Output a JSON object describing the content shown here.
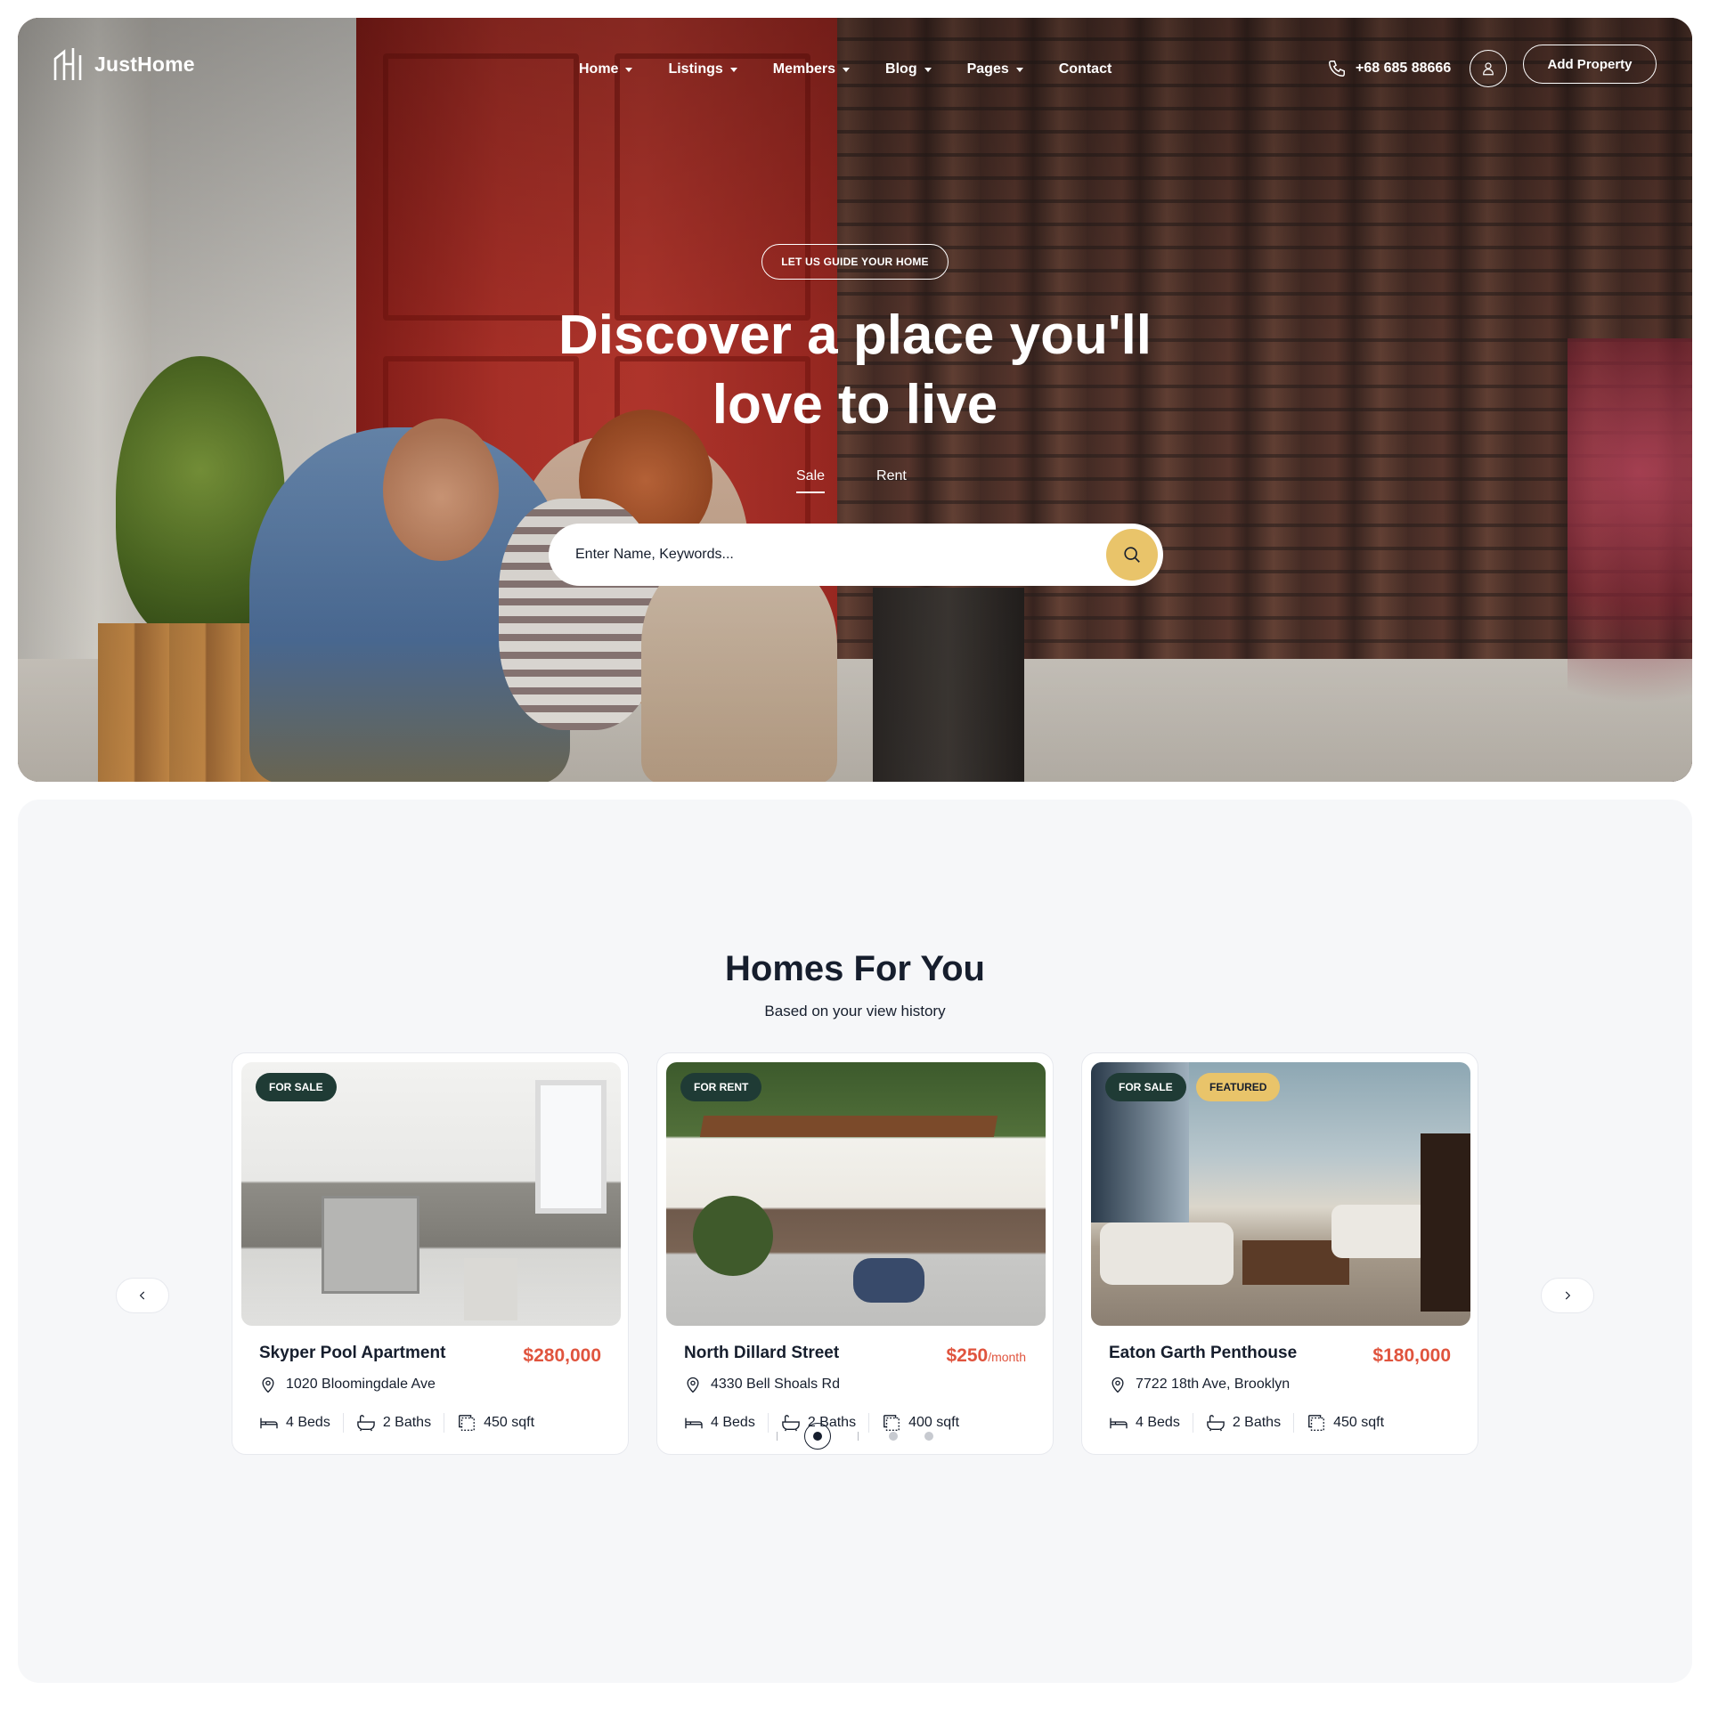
{
  "brand": {
    "name": "JustHome"
  },
  "nav": {
    "items": [
      {
        "label": "Home",
        "has_dropdown": true
      },
      {
        "label": "Listings",
        "has_dropdown": true
      },
      {
        "label": "Members",
        "has_dropdown": true
      },
      {
        "label": "Blog",
        "has_dropdown": true
      },
      {
        "label": "Pages",
        "has_dropdown": true
      },
      {
        "label": "Contact",
        "has_dropdown": false
      }
    ],
    "phone": "+68 685 88666",
    "add_property_label": "Add Property"
  },
  "hero": {
    "badge": "LET US GUIDE YOUR HOME",
    "title_line1": "Discover a place you'll",
    "title_line2": "love to live",
    "tabs": [
      {
        "label": "Sale",
        "active": true
      },
      {
        "label": "Rent",
        "active": false
      }
    ],
    "search_placeholder": "Enter Name, Keywords..."
  },
  "homes": {
    "title": "Homes For You",
    "subtitle": "Based on your view history",
    "listings": [
      {
        "tags": [
          "FOR SALE"
        ],
        "name": "Skyper Pool Apartment",
        "price": "$280,000",
        "price_suffix": "",
        "address": "1020 Bloomingdale Ave",
        "beds": "4 Beds",
        "baths": "2 Baths",
        "area": "450 sqft"
      },
      {
        "tags": [
          "FOR RENT"
        ],
        "name": "North Dillard Street",
        "price": "$250",
        "price_suffix": "/month",
        "address": "4330 Bell Shoals Rd",
        "beds": "4 Beds",
        "baths": "2 Baths",
        "area": "400 sqft"
      },
      {
        "tags": [
          "FOR SALE",
          "FEATURED"
        ],
        "name": "Eaton Garth Penthouse",
        "price": "$180,000",
        "price_suffix": "",
        "address": "7722 18th Ave, Brooklyn",
        "beds": "4 Beds",
        "baths": "2 Baths",
        "area": "450 sqft"
      }
    ],
    "pagination": {
      "pages": 3,
      "active": 1
    }
  },
  "colors": {
    "accent_yellow": "#e9c46a",
    "tag_dark_green": "#1f3b35",
    "price_red": "#e0543e",
    "text_dark": "#161e2d",
    "section_bg": "#f6f7f9"
  },
  "icons": {
    "logo": "house-bars-logo",
    "phone": "phone-icon",
    "user": "user-icon",
    "search": "search-icon",
    "location": "map-pin-icon",
    "beds": "bed-icon",
    "baths": "bathtub-icon",
    "area": "area-icon",
    "prev": "chevron-left-icon",
    "next": "chevron-right-icon"
  }
}
